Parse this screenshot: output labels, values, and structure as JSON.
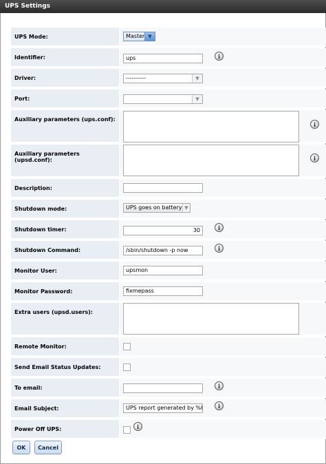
{
  "window": {
    "title": "UPS Settings"
  },
  "info_symbol": "i",
  "fields": {
    "ups_mode": {
      "label": "UPS Mode:",
      "value": "Master"
    },
    "identifier": {
      "label": "Identifier:",
      "value": "ups"
    },
    "driver": {
      "label": "Driver:",
      "value": "----------"
    },
    "port": {
      "label": "Port:",
      "value": ""
    },
    "aux_ups_conf": {
      "label": "Auxiliary parameters (ups.conf):",
      "value": ""
    },
    "aux_upsd_conf": {
      "label": "Auxiliary parameters (upsd.conf):",
      "value": ""
    },
    "description": {
      "label": "Description:",
      "value": ""
    },
    "shutdown_mode": {
      "label": "Shutdown mode:",
      "value": "UPS goes on battery"
    },
    "shutdown_timer": {
      "label": "Shutdown timer:",
      "value": "30"
    },
    "shutdown_command": {
      "label": "Shutdown Command:",
      "value": "/sbin/shutdown -p now"
    },
    "monitor_user": {
      "label": "Monitor User:",
      "value": "upsmon"
    },
    "monitor_password": {
      "label": "Monitor Password:",
      "value": "fixmepass"
    },
    "extra_users": {
      "label": "Extra users (upsd.users):",
      "value": ""
    },
    "remote_monitor": {
      "label": "Remote Monitor:",
      "checked": false
    },
    "send_email": {
      "label": "Send Email Status Updates:",
      "checked": false
    },
    "to_email": {
      "label": "To email:",
      "value": ""
    },
    "email_subject": {
      "label": "Email Subject:",
      "value": "UPS report generated by %h"
    },
    "power_off_ups": {
      "label": "Power Off UPS:",
      "checked": false
    }
  },
  "buttons": {
    "ok": "OK",
    "cancel": "Cancel"
  },
  "colors": {
    "titlebar": "#333333",
    "label_bg": "#e9eef4",
    "value_bg": "#f7f8fa",
    "button_border": "#7f9dc8"
  }
}
